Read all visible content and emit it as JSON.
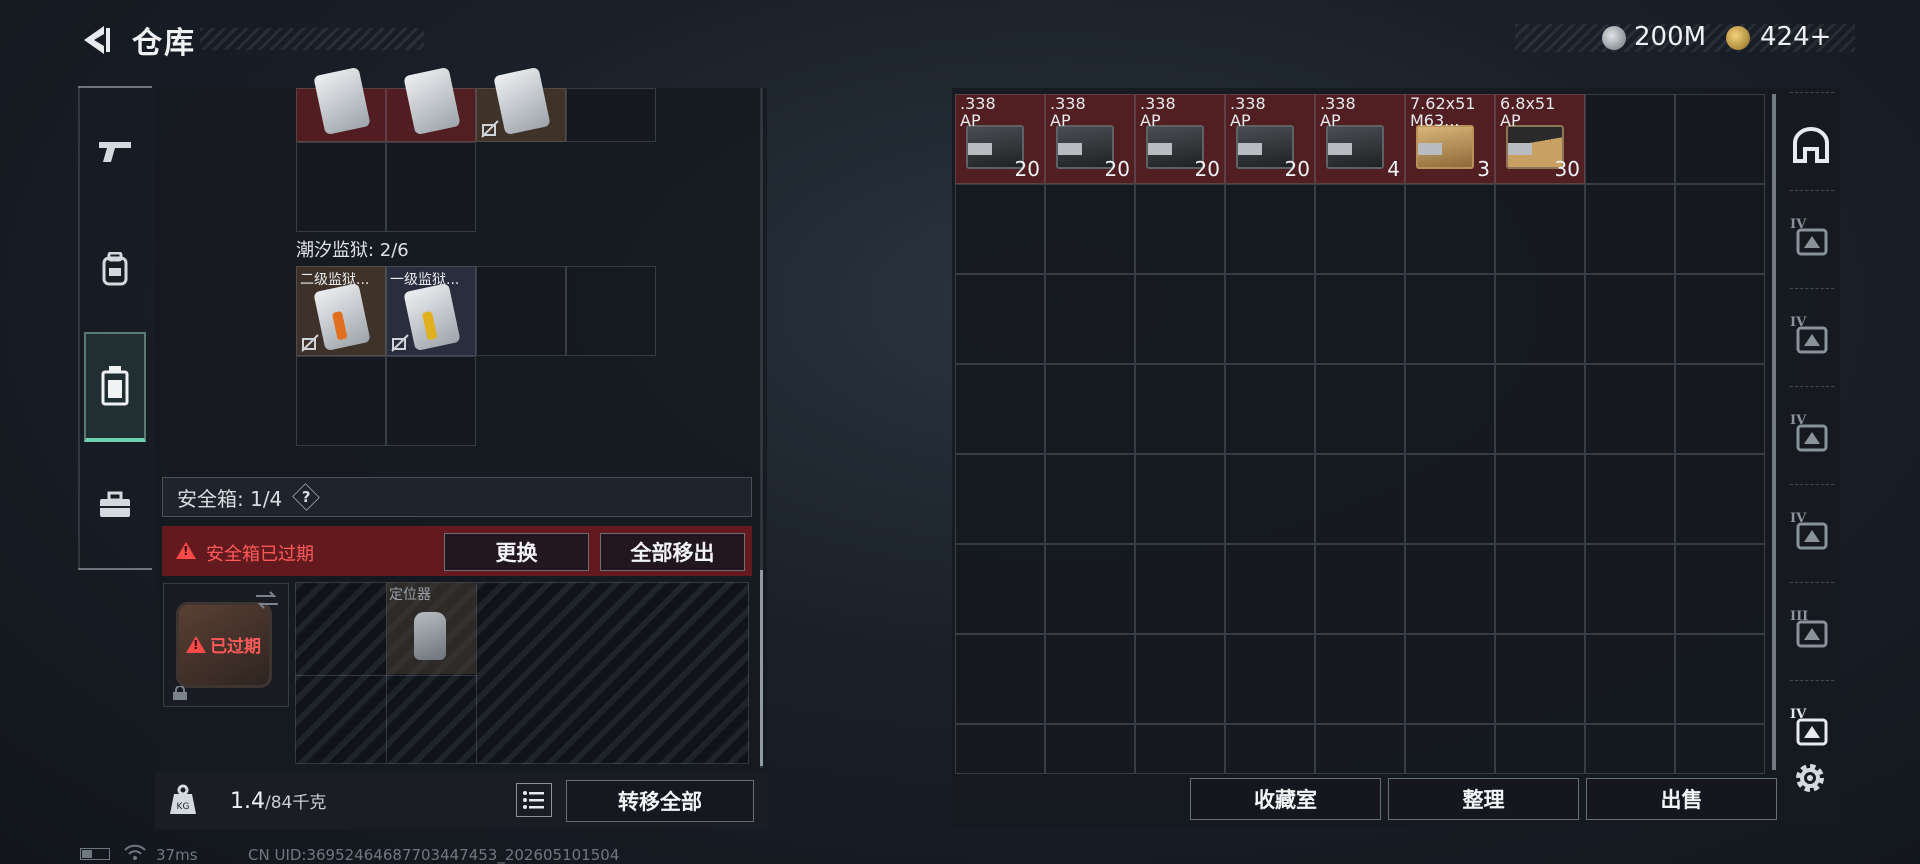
{
  "header": {
    "title": "仓库"
  },
  "currency": {
    "silver": "200M",
    "gold": "424+"
  },
  "left_sidebar": {
    "items": [
      {
        "name": "weapons-tab",
        "icon": "gun-icon"
      },
      {
        "name": "equipment-tab",
        "icon": "backpack-icon"
      },
      {
        "name": "containers-tab",
        "icon": "case-icon",
        "active": true
      },
      {
        "name": "toolbox-tab",
        "icon": "toolbox-icon"
      }
    ]
  },
  "containers": {
    "tidal_prison_label": "潮汐监狱: 2/6",
    "tidal_prison_cards": [
      {
        "name": "二级监狱...",
        "stripe": "#e07020"
      },
      {
        "name": "一级监狱...",
        "stripe": "#e0b020"
      }
    ],
    "safe_box_label": "安全箱:  1/4",
    "safe_box_help": "?",
    "expired_warning": "安全箱已过期",
    "replace_label": "更换",
    "remove_all_label": "全部移出",
    "box_expired_text": "已过期",
    "locator_name": "定位器"
  },
  "footer_left": {
    "weight_current": "1.4",
    "weight_max": "/84千克",
    "transfer_all_label": "转移全部"
  },
  "stash": {
    "items": [
      {
        "name": ".338\nAP",
        "count": "20",
        "style": "dark"
      },
      {
        "name": ".338\nAP",
        "count": "20",
        "style": "dark"
      },
      {
        "name": ".338\nAP",
        "count": "20",
        "style": "dark"
      },
      {
        "name": ".338\nAP",
        "count": "20",
        "style": "dark"
      },
      {
        "name": ".338\nAP",
        "count": "4",
        "style": "dark"
      },
      {
        "name": "7.62x51\nM63...",
        "count": "3",
        "style": "tan"
      },
      {
        "name": "6.8x51\nAP",
        "count": "30",
        "style": "mix"
      }
    ]
  },
  "actions": {
    "collection_label": "收藏室",
    "organize_label": "整理",
    "sell_label": "出售"
  },
  "right_sidebar": {
    "items": [
      {
        "name": "filter-all",
        "tier": ""
      },
      {
        "name": "filter-tier4-a",
        "tier": "IV"
      },
      {
        "name": "filter-tier4-b",
        "tier": "IV"
      },
      {
        "name": "filter-tier4-c",
        "tier": "IV"
      },
      {
        "name": "filter-tier4-d",
        "tier": "IV"
      },
      {
        "name": "filter-tier3",
        "tier": "III"
      },
      {
        "name": "filter-tier4-e",
        "tier": "IV"
      }
    ]
  },
  "status": {
    "ping": "37ms",
    "uid": "CN UID:36952464687703447453_202605101504"
  },
  "colors": {
    "accent": "#6fd1b0",
    "warning": "#ff4a4a",
    "item_red": "#5c1e22"
  }
}
